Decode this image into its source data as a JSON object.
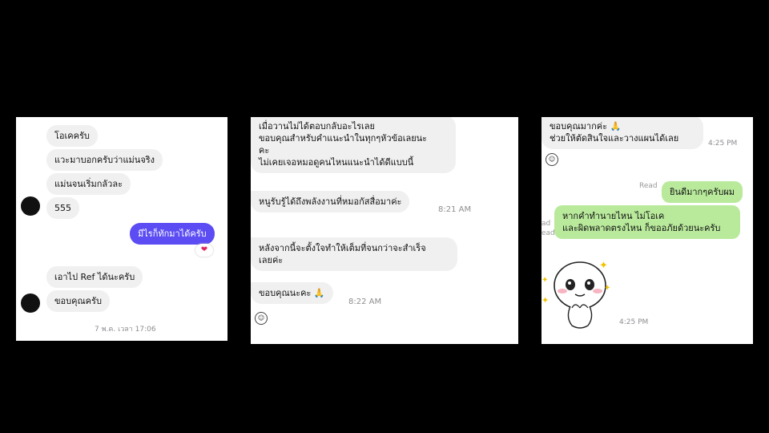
{
  "panel1": {
    "messages": [
      "โอเคครับ",
      "แวะมาบอกครับว่าแม่นจริง",
      "แม่นจนเริ่มกลัวละ",
      "555"
    ],
    "reply": "มีไรก็ทักมาได้ครับ",
    "reaction": "heart-icon",
    "messages2": [
      "เอาไป Ref ได้นะครับ",
      "ขอบคุณครับ"
    ],
    "timestamp": "7 พ.ค. เวลา 17:06",
    "accent": "#5b4cf3"
  },
  "panel2": {
    "msg1": [
      "เมื่อวานไม่ได้ตอบกลับอะไรเลย",
      "ขอบคุณสำหรับคำแนะนำในทุกๆหัวข้อเลยนะ",
      "คะ",
      "ไม่เคยเจอหมอดูคนไหนแนะนำได้ดีแบบนี้"
    ],
    "msg2": "หนูรับรู้ได้ถึงพลังงานที่หมอกัสสื่อมาค่ะ",
    "time1": "8:21 AM",
    "msg3": [
      "หลังจากนี้จะตั้งใจทำให้เต็มที่จนกว่าจะสำเร็จ",
      "เลยค่ะ"
    ],
    "msg4": "ขอบคุณนะคะ 🙏",
    "time2": "8:22 AM"
  },
  "panel3": {
    "msg1": [
      "ขอบคุณมากค่ะ 🙏",
      "ช่วยให้ตัดสินใจและวางแผนได้เลย"
    ],
    "time1": "4:25 PM",
    "read": "Read",
    "reply1": "ยินดีมากๆครับผม",
    "reply2": [
      "หากคำทำนายไหน ไม่โอเค",
      "และผิดพลาดตรงไหน ก็ขออภัยด้วยนะครับ"
    ],
    "read2": "ad",
    "read3": "ead",
    "time2": "4:25 PM",
    "accent": "#b9ea9c"
  }
}
